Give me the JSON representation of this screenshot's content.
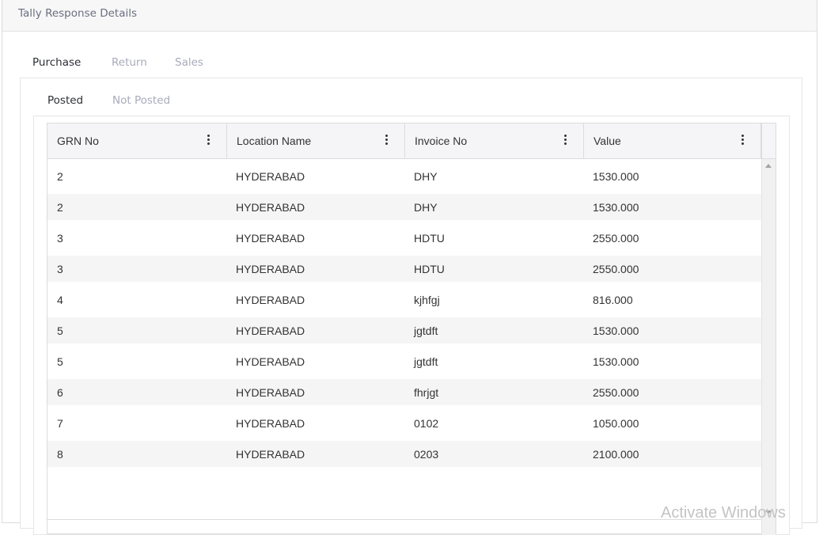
{
  "header": {
    "title": "Tally Response Details"
  },
  "tabs_top": [
    {
      "label": "Purchase",
      "active": true
    },
    {
      "label": "Return",
      "active": false
    },
    {
      "label": "Sales",
      "active": false
    }
  ],
  "tabs_sub": [
    {
      "label": "Posted",
      "active": true
    },
    {
      "label": "Not Posted",
      "active": false
    }
  ],
  "grid": {
    "columns": [
      "GRN No",
      "Location Name",
      "Invoice No",
      "Value"
    ],
    "rows": [
      [
        "2",
        "HYDERABAD",
        "DHY",
        "1530.000"
      ],
      [
        "2",
        "HYDERABAD",
        "DHY",
        "1530.000"
      ],
      [
        "3",
        "HYDERABAD",
        "HDTU",
        "2550.000"
      ],
      [
        "3",
        "HYDERABAD",
        "HDTU",
        "2550.000"
      ],
      [
        "4",
        "HYDERABAD",
        "kjhfgj",
        "816.000"
      ],
      [
        "5",
        "HYDERABAD",
        "jgtdft",
        "1530.000"
      ],
      [
        "5",
        "HYDERABAD",
        "jgtdft",
        "1530.000"
      ],
      [
        "6",
        "HYDERABAD",
        "fhrjgt",
        "2550.000"
      ],
      [
        "7",
        "HYDERABAD",
        "0102",
        "1050.000"
      ],
      [
        "8",
        "HYDERABAD",
        "0203",
        "2100.000"
      ]
    ]
  },
  "watermark": "Activate Windows",
  "icons": {
    "column_menu": "kebab-vertical-icon",
    "scroll_up": "scroll-up-arrow-icon",
    "scroll_down": "scroll-down-arrow-icon"
  }
}
